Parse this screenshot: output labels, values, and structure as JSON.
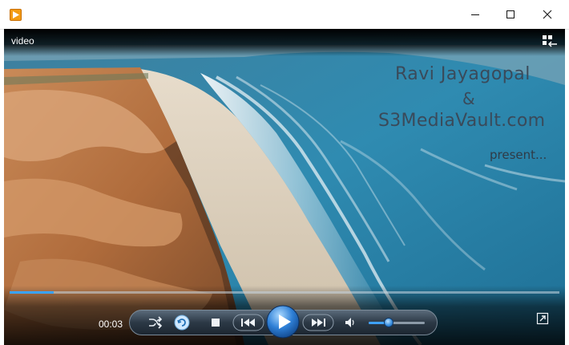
{
  "window": {
    "app_icon": "media-player-icon",
    "controls": {
      "minimize": "minimize-icon",
      "maximize": "maximize-icon",
      "close": "close-icon"
    }
  },
  "player": {
    "label": "video",
    "overlay_text": {
      "line1": "Ravi Jayagopal",
      "line2": "&",
      "line3": "S3MediaVault.com",
      "line4": "present..."
    },
    "current_time": "00:03",
    "progress_percent": 8,
    "volume_percent": 35,
    "accent_color": "#3aa3ff",
    "icons": {
      "switch_view": "switch-to-library-icon",
      "shuffle": "shuffle-icon",
      "repeat": "repeat-icon",
      "stop": "stop-icon",
      "previous": "previous-icon",
      "play": "play-icon",
      "next": "next-icon",
      "volume": "volume-icon",
      "fullscreen": "fullscreen-icon"
    }
  }
}
